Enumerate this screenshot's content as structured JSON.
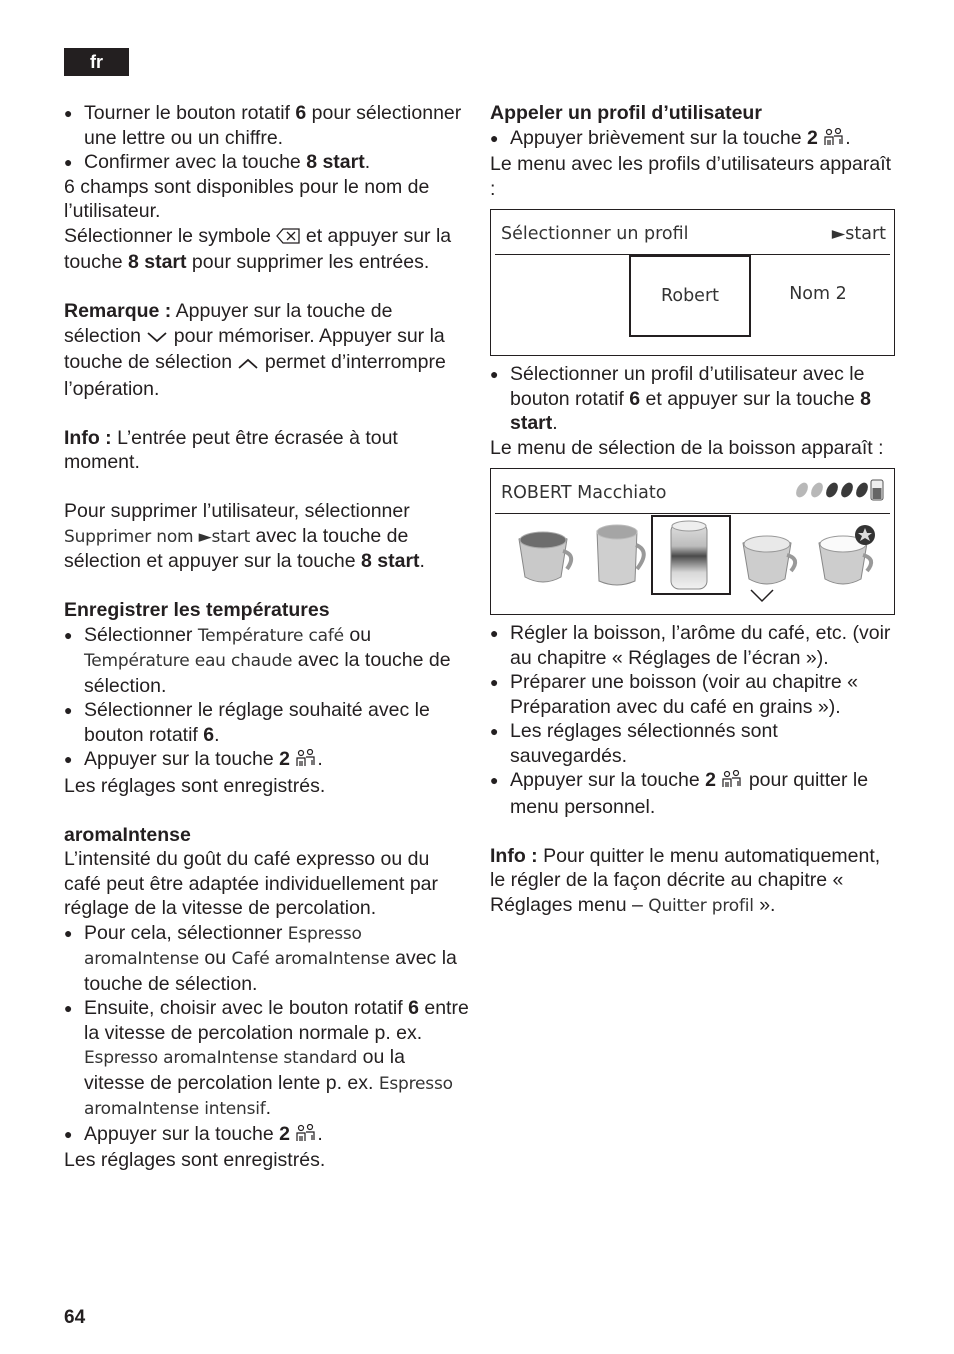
{
  "page": {
    "language_tab": "fr",
    "page_number": "64"
  },
  "left": {
    "b1": {
      "pre": "Tourner le bouton rotatif ",
      "bold": "6",
      "post": " pour sélection­ner une lettre ou un chiffre."
    },
    "b2": {
      "pre": "Confirmer avec la touche ",
      "bold": "8 start",
      "post": "."
    },
    "p1": "6 champs sont disponibles pour le nom de l’utilisateur.",
    "p2": {
      "pre": "Sélectionner le symbole ",
      "mid": " et appuyer sur la touche ",
      "bold": "8 start",
      "post": " pour supprimer les entrées."
    },
    "remarque": {
      "label": "Remarque :",
      "t1": " Appuyer sur la touche de sélection ",
      "t2": " pour mémoriser. Appuyer sur la touche de sélection ",
      "t3": " permet d’interrompre l’opération."
    },
    "info": {
      "label": "Info :",
      "text": " L’entrée peut être écrasée à tout moment."
    },
    "delete_user": {
      "pre": "Pour supprimer l’utilisateur, sélectionner ",
      "disp": "Supprimer nom ►start",
      "mid": " avec la touche de sélection et appuyer sur la touche ",
      "bold": "8 start",
      "post": "."
    },
    "temps": {
      "heading": "Enregistrer les températures",
      "b1": {
        "pre": "Sélectionner ",
        "disp1": "Température café",
        "mid": " ou ",
        "disp2": "Température eau chaude",
        "post": " avec la touche de sélection."
      },
      "b2": {
        "pre": "Sélectionner le réglage souhaité avec le bouton rotatif ",
        "bold": "6",
        "post": "."
      },
      "b3": {
        "pre": "Appuyer sur la touche ",
        "bold": "2",
        "post": "."
      },
      "after": "Les réglages sont enregistrés."
    },
    "aroma": {
      "heading": "aromaIntense",
      "intro": "L’intensité du goût du café expresso ou du café peut être adaptée individuellement par réglage de la vitesse de percolation.",
      "b1": {
        "pre": "Pour cela, sélectionner ",
        "disp1": "Espresso aromaIntense",
        "mid": " ou ",
        "disp2": "Café aromaIntense",
        "post": " avec la touche de sélection."
      },
      "b2": {
        "pre": "Ensuite, choisir avec le bouton rotatif ",
        "bold": "6",
        "mid1": " entre la vitesse de percolation normale p. ex. ",
        "disp1": "Espresso aromaIntense standard",
        "mid2": " ou la vitesse de percolation lente p. ex. ",
        "disp2": "Espresso aromaIntense intensif",
        "post": "."
      },
      "b3": {
        "pre": "Appuyer sur la touche ",
        "bold": "2",
        "post": "."
      },
      "after": "Les réglages sont enregistrés."
    }
  },
  "right": {
    "heading": "Appeler un profil d’utilisateur",
    "b1": {
      "pre": "Appuyer brièvement sur la touche ",
      "bold": "2",
      "post": "."
    },
    "p1": "Le menu avec les profils d’utilisateurs apparaît :",
    "profile_screen": {
      "title": "Sélectionner un profil",
      "action": "►start",
      "profiles": [
        "Robert",
        "Nom 2"
      ],
      "selected": "Robert"
    },
    "b2": {
      "pre": "Sélectionner un profil d’utilisateur avec le bouton rotatif ",
      "bold": "6",
      "mid": " et appuyer sur la touche ",
      "bold2": "8 start",
      "post": "."
    },
    "p2": "Le menu de sélection de la boisson apparaît :",
    "drink_screen": {
      "title": "ROBERT Macchiato",
      "strength_level": 3,
      "strength_max": 5,
      "drinks": [
        "espresso-cup",
        "coffee-mug",
        "latte-macchiato-glass",
        "cappuccino-cup",
        "favorite-cup"
      ],
      "selected_index": 2
    },
    "b3": "Régler la boisson, l’arôme du café, etc. (voir au chapitre « Réglages de l’écran »).",
    "b4": "Préparer une boisson (voir au chapitre « Préparation avec du café en grains »).",
    "b5": "Les réglages sélectionnés sont sauvegardés.",
    "b6": {
      "pre": "Appuyer sur la touche ",
      "bold": "2",
      "post": " pour quitter le menu personnel."
    },
    "info": {
      "label": "Info :",
      "pre": " Pour quitter le menu automatique­ment, le régler de la façon décrite au chapitre « Réglages menu – ",
      "disp": "Quitter profil",
      "post": " »."
    }
  }
}
